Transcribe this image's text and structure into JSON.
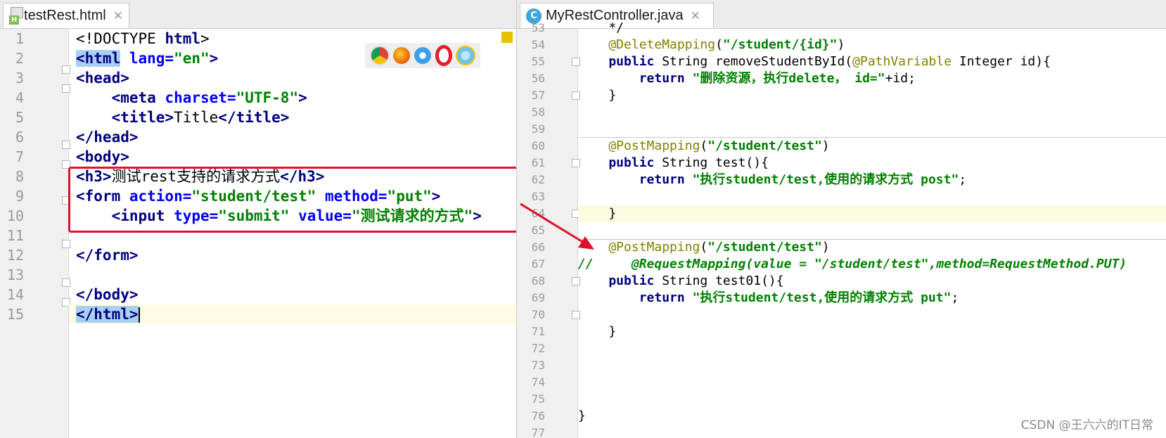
{
  "left_tab": {
    "title": "testRest.html",
    "close": "✕",
    "icon": "html-file-icon"
  },
  "right_tab": {
    "title": "MyRestController.java",
    "close": "✕",
    "icon_letter": "C"
  },
  "left_editor": {
    "line_numbers": [
      "1",
      "2",
      "3",
      "4",
      "5",
      "6",
      "7",
      "8",
      "9",
      "10",
      "11",
      "12",
      "13",
      "14",
      "15"
    ],
    "lines": {
      "l1_a": "<!DOCTYPE ",
      "l1_b": "html",
      "l1_c": ">",
      "l2_a": "<html",
      "l2_b": " lang=",
      "l2_c": "\"en\"",
      "l2_d": ">",
      "l3": "<head>",
      "l4_a": "    <meta",
      "l4_b": " charset=",
      "l4_c": "\"UTF-8\"",
      "l4_d": ">",
      "l5_a": "    <title>",
      "l5_b": "Title",
      "l5_c": "</title>",
      "l6": "</head>",
      "l7": "<body>",
      "l8_a": "<h3>",
      "l8_b": "测试rest支持的请求方式",
      "l8_c": "</h3>",
      "l9_a": "<form",
      "l9_b": " action=",
      "l9_c": "\"student/test\"",
      "l9_d": " method=",
      "l9_e": "\"put\"",
      "l9_f": ">",
      "l10_a": "    <input",
      "l10_b": " type=",
      "l10_c": "\"submit\"",
      "l10_d": " value=",
      "l10_e": "\"测试请求的方式\"",
      "l10_f": ">",
      "l12": "</form>",
      "l14": "</body>",
      "l15": "</html>"
    }
  },
  "right_editor": {
    "line_numbers": [
      "53",
      "54",
      "55",
      "56",
      "57",
      "58",
      "59",
      "60",
      "61",
      "62",
      "63",
      "64",
      "65",
      "66",
      "67",
      "68",
      "69",
      "70",
      "71",
      "72",
      "73",
      "74",
      "75",
      "76",
      "77"
    ],
    "lines": {
      "r53": "    */",
      "r54_a": "    @DeleteMapping",
      "r54_b": "(",
      "r54_c": "\"/student/{id}\"",
      "r54_d": ")",
      "r55_a": "    public ",
      "r55_b": "String removeStudentById(",
      "r55_c": "@PathVariable",
      "r55_d": " Integer id){",
      "r56_a": "        return ",
      "r56_b": "\"删除资源，执行delete， id=\"",
      "r56_c": "+id;",
      "r57": "    }",
      "r60_a": "    @PostMapping",
      "r60_b": "(",
      "r60_c": "\"/student/test\"",
      "r60_d": ")",
      "r61_a": "    public ",
      "r61_b": "String test(){",
      "r62_a": "        return ",
      "r62_b": "\"执行student/test,使用的请求方式 post\"",
      "r62_c": ";",
      "r64": "    }",
      "r66_a": "    @PostMapping",
      "r66_b": "(",
      "r66_c": "\"/student/test\"",
      "r66_d": ")",
      "r67": "//     @RequestMapping(value = \"/student/test\",method=RequestMethod.PUT)",
      "r68_a": "    public ",
      "r68_b": "String test01(){",
      "r69_a": "        return ",
      "r69_b": "\"执行student/test,使用的请求方式 put\"",
      "r69_c": ";",
      "r71": "    }",
      "r76": "}"
    }
  },
  "browser_icons": [
    "chrome-icon",
    "firefox-icon",
    "safari-icon",
    "opera-icon",
    "ie-icon"
  ],
  "colors": {
    "highlight_box": "#e0102b",
    "arrow": "#e0102b"
  },
  "watermark": "CSDN @王六六的IT日常"
}
